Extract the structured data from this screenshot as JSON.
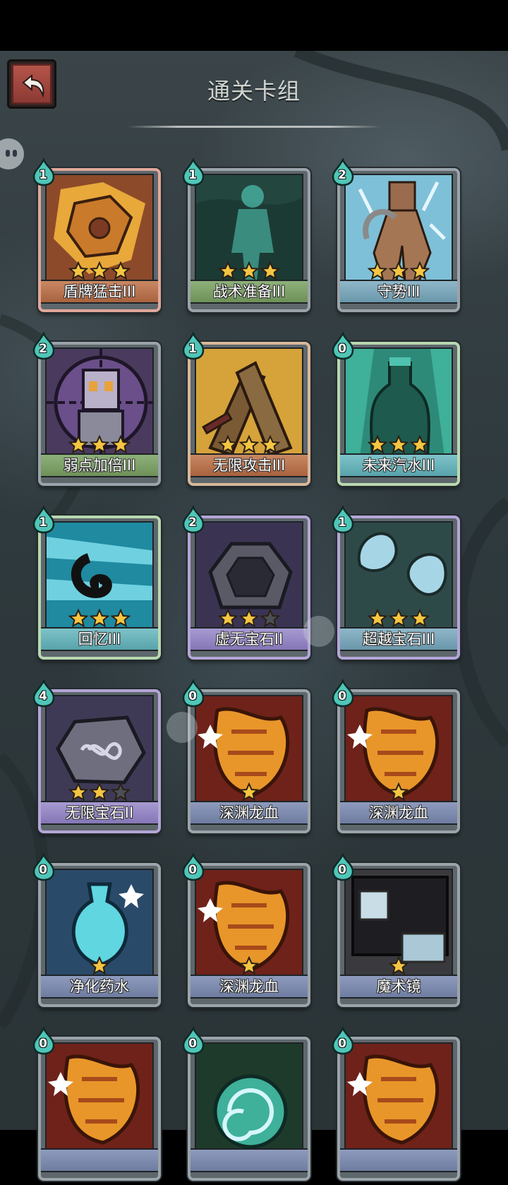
{
  "header": {
    "title": "通关卡组"
  },
  "cards": [
    {
      "name": "盾牌猛击III",
      "cost": "1",
      "stars": 3,
      "max_stars": 3,
      "bar": "orange",
      "frame": "rare",
      "art": "shield-bash"
    },
    {
      "name": "战术准备III",
      "cost": "1",
      "stars": 3,
      "max_stars": 3,
      "bar": "green",
      "frame": "normal",
      "art": "ghost-figure"
    },
    {
      "name": "守势III",
      "cost": "2",
      "stars": 3,
      "max_stars": 3,
      "bar": "blue",
      "frame": "normal",
      "art": "defense-stance"
    },
    {
      "name": "弱点加倍III",
      "cost": "2",
      "stars": 3,
      "max_stars": 3,
      "bar": "green",
      "frame": "normal",
      "art": "robot-target"
    },
    {
      "name": "无限攻击III",
      "cost": "1",
      "stars": 3,
      "max_stars": 3,
      "bar": "orange",
      "frame": "gold",
      "art": "crossed-swords"
    },
    {
      "name": "未来汽水III",
      "cost": "0",
      "stars": 3,
      "max_stars": 3,
      "bar": "cyan",
      "frame": "green",
      "art": "soda-bottle"
    },
    {
      "name": "回忆III",
      "cost": "1",
      "stars": 3,
      "max_stars": 3,
      "bar": "cyan",
      "frame": "green",
      "art": "memory-swirl"
    },
    {
      "name": "虚无宝石II",
      "cost": "2",
      "stars": 2,
      "max_stars": 3,
      "bar": "purple",
      "frame": "purple",
      "art": "void-gem"
    },
    {
      "name": "超越宝石III",
      "cost": "1",
      "stars": 3,
      "max_stars": 3,
      "bar": "blue",
      "frame": "purple",
      "art": "twin-gems"
    },
    {
      "name": "无限宝石II",
      "cost": "4",
      "stars": 2,
      "max_stars": 3,
      "bar": "purple",
      "frame": "purple",
      "art": "infinity-gem"
    },
    {
      "name": "深渊龙血",
      "cost": "0",
      "stars": 1,
      "max_stars": 1,
      "bar": "slate",
      "frame": "normal",
      "art": "dragon-blood"
    },
    {
      "name": "深渊龙血",
      "cost": "0",
      "stars": 1,
      "max_stars": 1,
      "bar": "slate",
      "frame": "normal",
      "art": "dragon-blood"
    },
    {
      "name": "净化药水",
      "cost": "0",
      "stars": 1,
      "max_stars": 1,
      "bar": "slate",
      "frame": "normal",
      "art": "purify-potion"
    },
    {
      "name": "深渊龙血",
      "cost": "0",
      "stars": 1,
      "max_stars": 1,
      "bar": "slate",
      "frame": "normal",
      "art": "dragon-blood"
    },
    {
      "name": "魔术镜",
      "cost": "0",
      "stars": 1,
      "max_stars": 1,
      "bar": "slate",
      "frame": "normal",
      "art": "magic-mirror"
    },
    {
      "name": "",
      "cost": "0",
      "stars": 0,
      "max_stars": 0,
      "bar": "slate",
      "frame": "normal",
      "art": "dragon-blood"
    },
    {
      "name": "",
      "cost": "0",
      "stars": 0,
      "max_stars": 0,
      "bar": "slate",
      "frame": "normal",
      "art": "swirl-orb"
    },
    {
      "name": "",
      "cost": "0",
      "stars": 0,
      "max_stars": 0,
      "bar": "slate",
      "frame": "normal",
      "art": "dragon-blood"
    }
  ],
  "colors": {
    "star_gold": "#f5c542",
    "star_empty": "#4a4f55",
    "cost_drop": "#4fc6b8"
  }
}
